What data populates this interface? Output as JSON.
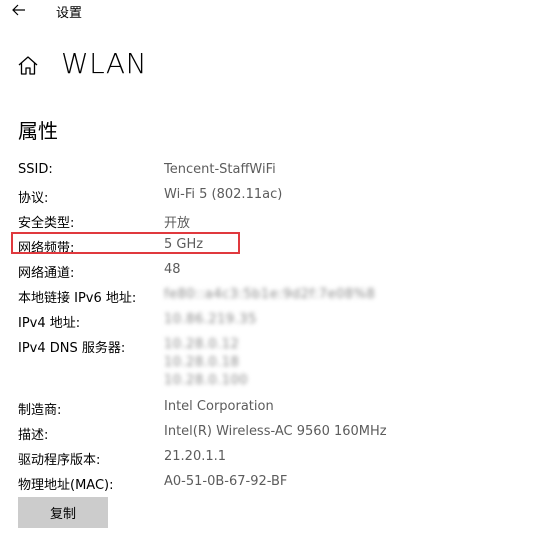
{
  "window": {
    "title": "设置"
  },
  "header": {
    "title": "WLAN"
  },
  "section": {
    "title": "属性"
  },
  "properties": [
    {
      "label": "SSID:",
      "value": "Tencent-StaffWiFi"
    },
    {
      "label": "协议:",
      "value": "Wi-Fi 5 (802.11ac)"
    },
    {
      "label": "安全类型:",
      "value": "开放"
    },
    {
      "label": "网络频带:",
      "value": "5 GHz"
    },
    {
      "label": "网络通道:",
      "value": "48"
    },
    {
      "label": "本地链接 IPv6 地址:",
      "value": "fe80::a4c3:5b1e:9d2f:7e08%8"
    },
    {
      "label": "IPv4 地址:",
      "value": "10.86.219.35"
    },
    {
      "label": "IPv4 DNS 服务器:",
      "value": [
        "10.28.0.12",
        "10.28.0.18",
        "10.28.0.100"
      ]
    },
    {
      "label": "制造商:",
      "value": "Intel Corporation"
    },
    {
      "label": "描述:",
      "value": "Intel(R) Wireless-AC 9560 160MHz"
    },
    {
      "label": "驱动程序版本:",
      "value": "21.20.1.1"
    },
    {
      "label": "物理地址(MAC):",
      "value": "A0-51-0B-67-92-BF"
    }
  ],
  "actions": {
    "copy_label": "复制"
  },
  "colors": {
    "highlight": "#e0393e",
    "button_bg": "#cccccc",
    "value_text": "#5c5c5c"
  }
}
